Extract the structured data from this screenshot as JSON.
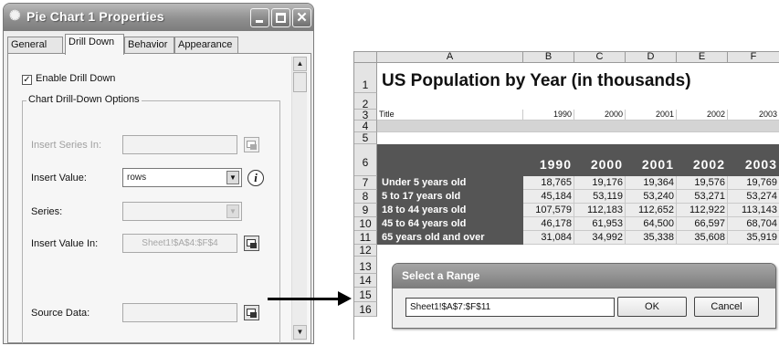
{
  "dialog": {
    "title": "Pie Chart 1 Properties",
    "icon": "gear-icon",
    "tabs": [
      "General",
      "Drill Down",
      "Behavior",
      "Appearance"
    ],
    "active_tab": "Drill Down",
    "enable_drill_down": {
      "label": "Enable Drill Down",
      "checked": true,
      "mark": "✓"
    },
    "group_label": "Chart Drill-Down Options",
    "insert_series_in": {
      "label": "Insert Series In:",
      "value": ""
    },
    "insert_value": {
      "label": "Insert Value:",
      "value": "rows",
      "info": "i"
    },
    "series": {
      "label": "Series:",
      "value": ""
    },
    "insert_value_in": {
      "label": "Insert Value In:",
      "value": "Sheet1!$A$4:$F$4"
    },
    "source_data": {
      "label": "Source Data:",
      "value": ""
    }
  },
  "sheet": {
    "columns": [
      "A",
      "B",
      "C",
      "D",
      "E",
      "F"
    ],
    "rows": [
      "1",
      "2",
      "3",
      "4",
      "5",
      "6",
      "7",
      "8",
      "9",
      "10",
      "11",
      "12",
      "13",
      "14",
      "15",
      "16"
    ],
    "title": "US Population by Year (in thousands)",
    "row3": {
      "label": "Title",
      "values": [
        "1990",
        "2000",
        "2001",
        "2002",
        "2003"
      ]
    },
    "years": [
      "1990",
      "2000",
      "2001",
      "2002",
      "2003"
    ],
    "data": [
      {
        "label": "Under 5 years old",
        "values": [
          "18,765",
          "19,176",
          "19,364",
          "19,576",
          "19,769"
        ]
      },
      {
        "label": "5 to 17 years old",
        "values": [
          "45,184",
          "53,119",
          "53,240",
          "53,271",
          "53,274"
        ]
      },
      {
        "label": "18 to 44 years old",
        "values": [
          "107,579",
          "112,183",
          "112,652",
          "112,922",
          "113,143"
        ]
      },
      {
        "label": "45 to 64 years old",
        "values": [
          "46,178",
          "61,953",
          "64,500",
          "66,597",
          "68,704"
        ]
      },
      {
        "label": "65 years old and over",
        "values": [
          "31,084",
          "34,992",
          "35,338",
          "35,608",
          "35,919"
        ]
      }
    ]
  },
  "range_dialog": {
    "title": "Select a Range",
    "value": "Sheet1!$A$7:$F$11",
    "ok": "OK",
    "cancel": "Cancel"
  }
}
